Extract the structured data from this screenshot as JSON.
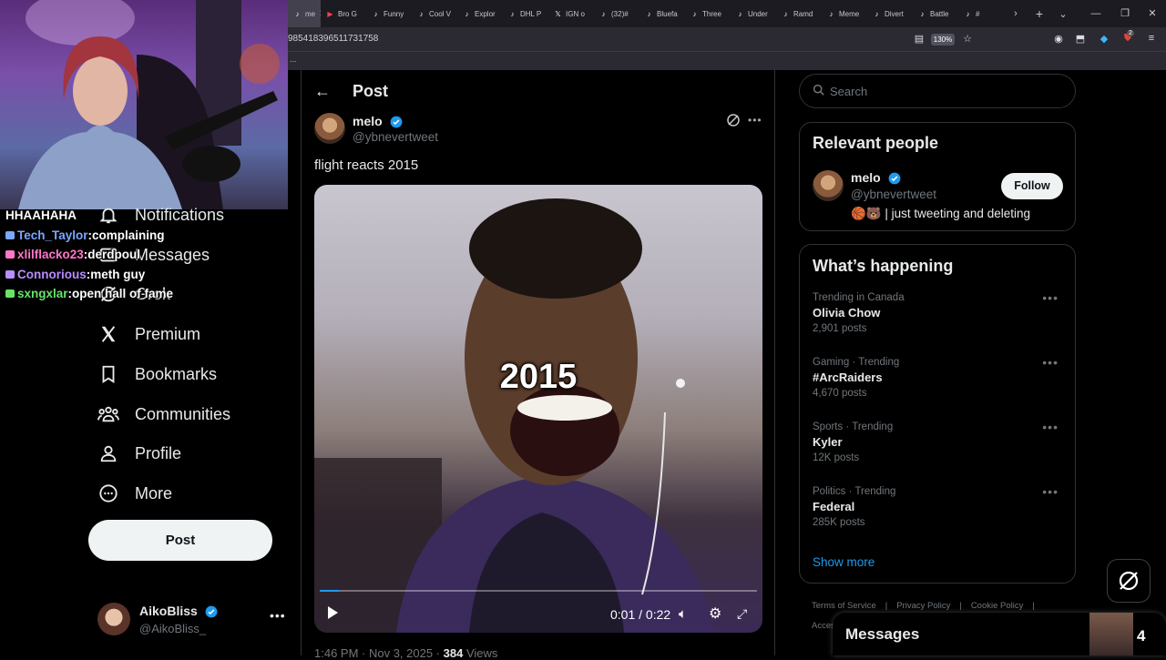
{
  "browser": {
    "tabs": [
      {
        "label": "me",
        "icon": "tiktok-icon",
        "active": true
      },
      {
        "label": "Bro G",
        "icon": "youtube-icon"
      },
      {
        "label": "Funny",
        "icon": "tiktok-icon"
      },
      {
        "label": "Cool V",
        "icon": "tiktok-icon"
      },
      {
        "label": "Explor",
        "icon": "tiktok-icon"
      },
      {
        "label": "DHL P",
        "icon": "tiktok-icon"
      },
      {
        "label": "IGN o",
        "icon": "x-icon"
      },
      {
        "label": "(32)#",
        "icon": "tiktok-icon"
      },
      {
        "label": "Bluefa",
        "icon": "tiktok-icon"
      },
      {
        "label": "Three",
        "icon": "tiktok-icon"
      },
      {
        "label": "Under",
        "icon": "tiktok-icon"
      },
      {
        "label": "Ramd",
        "icon": "tiktok-icon"
      },
      {
        "label": "Meme",
        "icon": "tiktok-icon"
      },
      {
        "label": "Divert",
        "icon": "tiktok-icon"
      },
      {
        "label": "Battle",
        "icon": "tiktok-icon"
      },
      {
        "label": "#",
        "icon": "tiktok-icon"
      }
    ],
    "url_fragment": "985418396511731758",
    "zoom": "130%",
    "bookmarks_overflow": "...",
    "notification_count": "2"
  },
  "accent_colors": {
    "x_blue": "#1d9bf0",
    "background": "#000000",
    "muted": "#71767b"
  },
  "chat": [
    {
      "user": "",
      "message": "HHAAHAHA",
      "user_color": "#ffffff"
    },
    {
      "user": "Tech_Taylor",
      "message": "complaining",
      "user_color": "#7aa7ff"
    },
    {
      "user": "xlilflacko23",
      "message": "derdpoul",
      "user_color": "#ff77c8"
    },
    {
      "user": "Connorious",
      "message": "meth guy",
      "user_color": "#b98cff"
    },
    {
      "user": "sxngxlar",
      "message": "open hall of fame",
      "user_color": "#67e36a"
    }
  ],
  "sidebar": {
    "items": [
      {
        "label": "Notifications",
        "icon": "bell-icon"
      },
      {
        "label": "Messages",
        "icon": "envelope-icon"
      },
      {
        "label": "Grok",
        "icon": "grok-icon"
      },
      {
        "label": "Premium",
        "icon": "x-logo-icon"
      },
      {
        "label": "Bookmarks",
        "icon": "bookmark-icon"
      },
      {
        "label": "Communities",
        "icon": "communities-icon"
      },
      {
        "label": "Profile",
        "icon": "person-icon"
      },
      {
        "label": "More",
        "icon": "more-circle-icon"
      }
    ],
    "post_button": "Post",
    "account": {
      "name": "AikoBliss",
      "handle": "@AikoBliss_"
    }
  },
  "center": {
    "header_title": "Post",
    "tweet": {
      "author_name": "melo",
      "author_handle": "@ybnevertweet",
      "text": "flight reacts 2015",
      "media_caption": "2015",
      "video_time": "0:01 / 0:22",
      "video_progress": 0.045,
      "timestamp": "1:46 PM · Nov 3, 2025 ·",
      "views_count": "384",
      "views_label": "Views"
    }
  },
  "right": {
    "search_placeholder": "Search",
    "relevant_people": {
      "title": "Relevant people",
      "name": "melo",
      "handle": "@ybnevertweet",
      "bio": "🏀🐻 | just tweeting and deleting",
      "follow_label": "Follow"
    },
    "happening": {
      "title": "What’s happening",
      "trends": [
        {
          "context": "Trending in Canada",
          "name": "Olivia Chow",
          "count": "2,901 posts"
        },
        {
          "context": "Gaming · Trending",
          "name": "#ArcRaiders",
          "count": "4,670 posts"
        },
        {
          "context": "Sports · Trending",
          "name": "Kyler",
          "count": "12K posts"
        },
        {
          "context": "Politics · Trending",
          "name": "Federal",
          "count": "285K posts"
        }
      ],
      "show_more": "Show more"
    },
    "footer_links": [
      "Terms of Service",
      "|",
      "Privacy Policy",
      "|",
      "Cookie Policy",
      "|",
      "Access"
    ],
    "messages_title": "Messages",
    "viewer_count": "4"
  }
}
